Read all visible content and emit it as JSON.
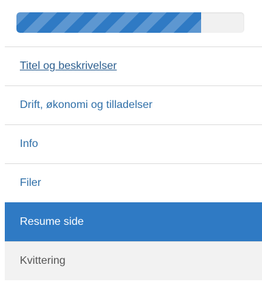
{
  "progress": {
    "value": 0.81,
    "color": "#2f7ac4"
  },
  "nav": {
    "items": [
      {
        "label": "Titel og beskrivelser",
        "state": "visited"
      },
      {
        "label": "Drift, økonomi og tilladelser",
        "state": "default"
      },
      {
        "label": "Info",
        "state": "default"
      },
      {
        "label": "Filer",
        "state": "default"
      },
      {
        "label": "Resume side",
        "state": "active"
      },
      {
        "label": "Kvittering",
        "state": "disabled"
      }
    ]
  },
  "colors": {
    "accent": "#2f7ac4",
    "link": "#2f6fa8",
    "disabled_bg": "#f2f2f2"
  }
}
